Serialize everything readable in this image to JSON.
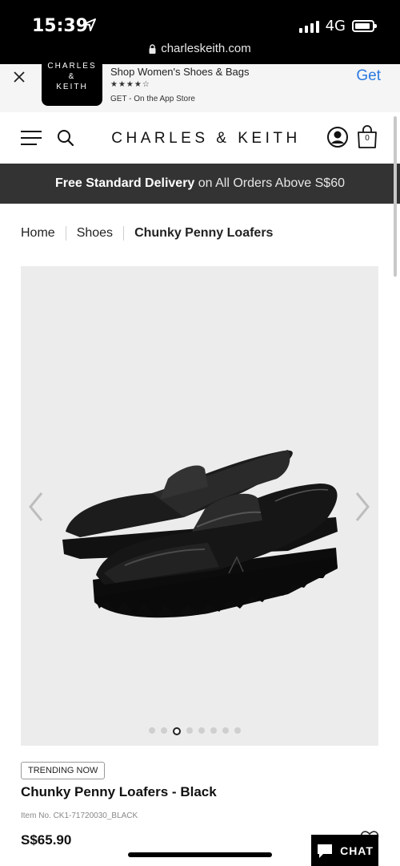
{
  "status": {
    "time": "15:39",
    "network": "4G",
    "url": "charleskeith.com"
  },
  "app_banner": {
    "logo_line1": "CHARLES",
    "logo_line2": "&",
    "logo_line3": "KEITH",
    "title": "Shop Women's Shoes & Bags",
    "stars": "★★★★☆",
    "subtitle": "GET - On the App Store",
    "get_label": "Get"
  },
  "header": {
    "brand": "CHARLES & KEITH",
    "bag_count": "0"
  },
  "promo": {
    "bold": "Free Standard Delivery",
    "rest": " on All Orders Above S$60"
  },
  "breadcrumb": {
    "items": [
      "Home",
      "Shoes"
    ],
    "current": "Chunky Penny Loafers"
  },
  "gallery": {
    "dot_count": 8,
    "active_index": 2
  },
  "product": {
    "badge": "TRENDING NOW",
    "name": "Chunky Penny Loafers - Black",
    "item_no": "Item No. CK1-71720030_BLACK",
    "price": "S$65.90"
  },
  "chat": {
    "label": "CHAT"
  },
  "colors": {
    "promo_bg": "#333333",
    "accent": "#2a7ae2",
    "gallery_bg": "#ececec"
  }
}
